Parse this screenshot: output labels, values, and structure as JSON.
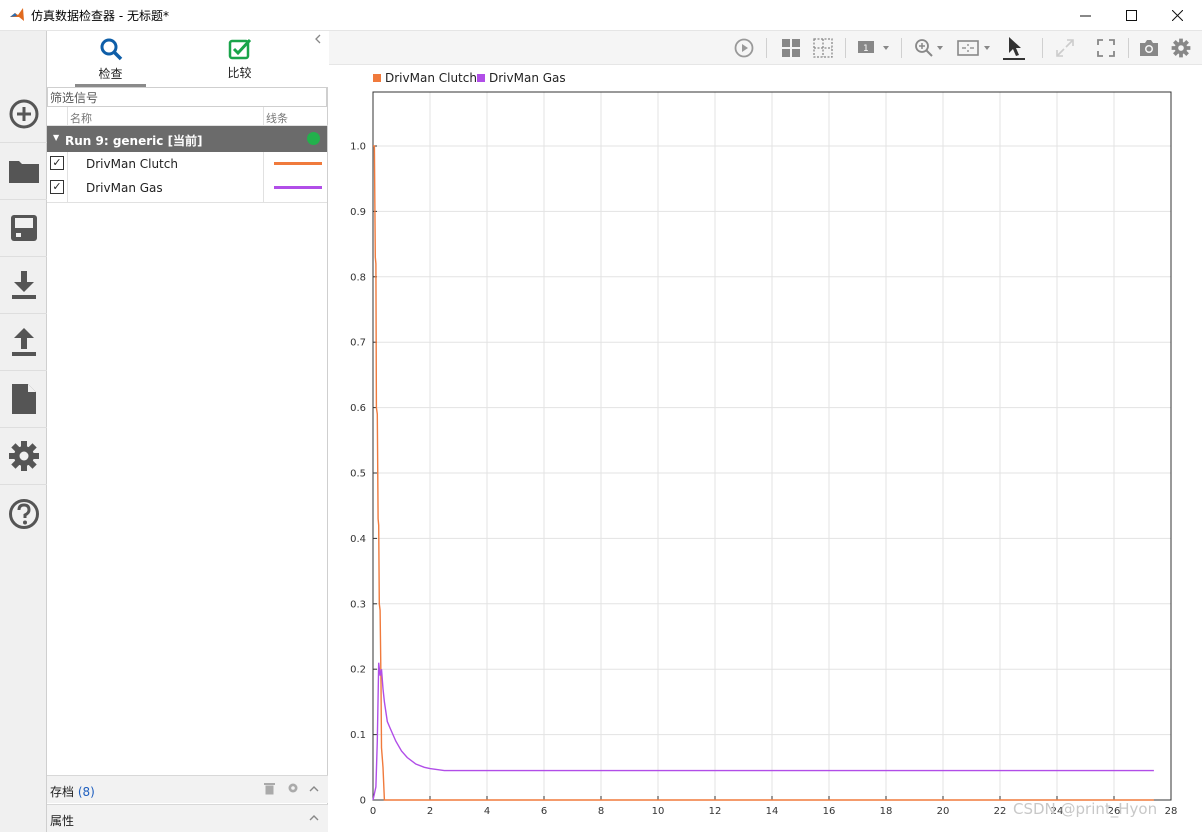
{
  "window": {
    "title": "仿真数据检查器 - 无标题*",
    "minimize_icon": "minimize-icon",
    "maximize_icon": "maximize-icon",
    "close_icon": "close-icon"
  },
  "rail": {
    "items": [
      "new-icon",
      "open-folder-icon",
      "save-icon",
      "import-icon",
      "export-icon",
      "report-icon",
      "settings-icon",
      "help-icon"
    ]
  },
  "panel": {
    "tabs": [
      {
        "label": "检查",
        "icon": "search-icon",
        "active": true
      },
      {
        "label": "比较",
        "icon": "checkmark-icon",
        "active": false
      }
    ],
    "filter_placeholder": "筛选信号",
    "columns": {
      "name": "名称",
      "line": "线条"
    },
    "run": {
      "label": "Run 9: generic [当前]",
      "status_color": "#22b14c"
    },
    "signals": [
      {
        "name": "DrivMan Clutch",
        "checked": true,
        "color": "#f07a3c"
      },
      {
        "name": "DrivMan Gas",
        "checked": true,
        "color": "#b14ee8"
      }
    ],
    "archive": {
      "label": "存档",
      "count": "(8)"
    },
    "properties": {
      "label": "属性"
    }
  },
  "toolbar": {
    "icons": [
      "play-icon",
      "layout-icon",
      "subplot-grid-icon",
      "subplot-select-icon",
      "zoom-icon",
      "fit-to-view-icon",
      "cursor-icon",
      "expand-icon",
      "fullscreen-icon",
      "camera-icon",
      "gear-icon"
    ]
  },
  "chart_data": {
    "type": "line",
    "title": "",
    "xlabel": "",
    "ylabel": "",
    "xlim": [
      0,
      28
    ],
    "ylim": [
      0,
      1.0
    ],
    "x_ticks": [
      0,
      2,
      4,
      6,
      8,
      10,
      12,
      14,
      16,
      18,
      20,
      22,
      24,
      26,
      28
    ],
    "y_ticks": [
      0,
      0.1,
      0.2,
      0.3,
      0.4,
      0.5,
      0.6,
      0.7,
      0.8,
      0.9,
      1.0
    ],
    "y_tick_labels": [
      "0",
      "0.1",
      "0.2",
      "0.3",
      "0.4",
      "0.5",
      "0.6",
      "0.7",
      "0.8",
      "0.9",
      "1.0"
    ],
    "grid": true,
    "legend_position": "top-left",
    "series": [
      {
        "name": "DrivMan Clutch",
        "color": "#f07a3c",
        "x": [
          0,
          0.05,
          0.08,
          0.1,
          0.12,
          0.15,
          0.18,
          0.2,
          0.22,
          0.25,
          0.28,
          0.3,
          0.35,
          0.4,
          0.5,
          1,
          5,
          10,
          15,
          20,
          25,
          27.4
        ],
        "y": [
          1.0,
          1.0,
          0.83,
          0.82,
          0.6,
          0.59,
          0.43,
          0.42,
          0.3,
          0.29,
          0.18,
          0.08,
          0.05,
          0.0,
          0.0,
          0.0,
          0.0,
          0.0,
          0.0,
          0.0,
          0.0,
          0.0
        ]
      },
      {
        "name": "DrivMan Gas",
        "color": "#b14ee8",
        "x": [
          0,
          0.1,
          0.15,
          0.2,
          0.25,
          0.3,
          0.35,
          0.4,
          0.5,
          0.6,
          0.8,
          1.0,
          1.2,
          1.5,
          1.8,
          2.0,
          2.5,
          5,
          10,
          15,
          20,
          25,
          27.4
        ],
        "y": [
          0.0,
          0.02,
          0.09,
          0.21,
          0.19,
          0.2,
          0.17,
          0.15,
          0.12,
          0.11,
          0.09,
          0.075,
          0.065,
          0.055,
          0.05,
          0.048,
          0.045,
          0.045,
          0.045,
          0.045,
          0.045,
          0.045,
          0.045
        ]
      }
    ]
  },
  "watermark": "CSDN @print_Hyon"
}
